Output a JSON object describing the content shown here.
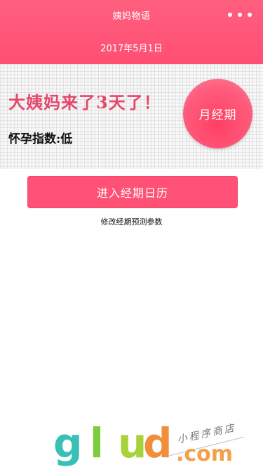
{
  "header": {
    "title": "姨妈物语",
    "date": "2017年5月1日"
  },
  "status": {
    "main": "大姨妈来了3天了！",
    "fertility": "怀孕指数:低",
    "phase": "月经期"
  },
  "actions": {
    "calendar_button": "进入经期日历",
    "modify_link": "修改经期预测参数"
  },
  "watermark": {
    "g": "g",
    "l": "l",
    "u": "u",
    "d": "d",
    "com": ".com",
    "caption": "小程序商店"
  },
  "colors": {
    "brand": "#ff5175",
    "header": "#ff5f7f",
    "status_text": "#e8466b"
  },
  "icons": {
    "more": "three-dots-icon"
  }
}
